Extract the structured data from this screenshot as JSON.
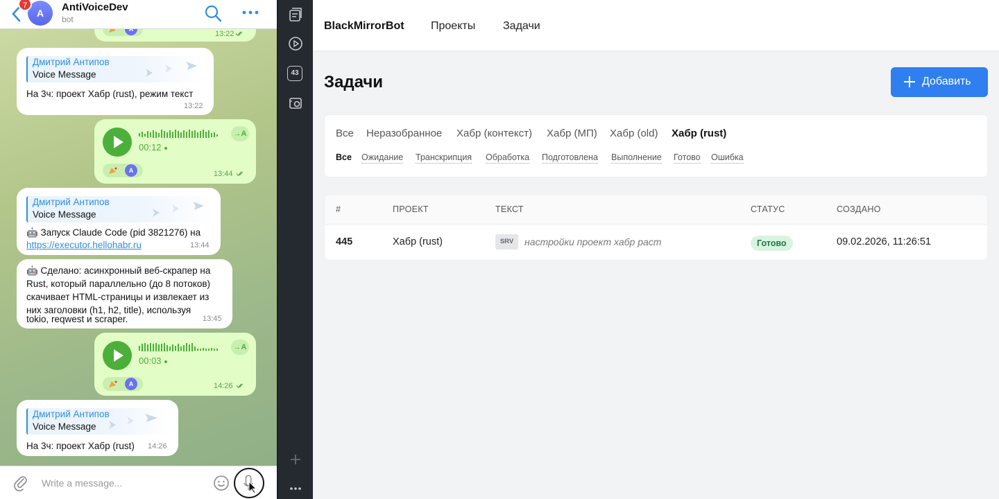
{
  "telegram": {
    "unread_count": "7",
    "chat_avatar_letter": "A",
    "chat_title": "AntiVoiceDev",
    "chat_subtitle": "bot",
    "compose_placeholder": "Write a message...",
    "messages": [
      {
        "kind": "voice",
        "time": "13:22"
      },
      {
        "kind": "forwarded",
        "sender": "Дмитрий Антипов",
        "type_label": "Voice Message",
        "text": "На 3ч: проект Хабр (rust), режим текст",
        "time": "13:22"
      },
      {
        "kind": "voice",
        "duration": "00:12",
        "to_text": "→A",
        "reaction_avatar": "A",
        "time": "13:44"
      },
      {
        "kind": "forwarded",
        "sender": "Дмитрий Антипов",
        "type_label": "Voice Message",
        "text": "🤖 Запуск Claude Code (pid 3821276) на",
        "link": "https://executor.hellohabr.ru",
        "time": "13:44"
      },
      {
        "kind": "text",
        "lines": [
          "🤖 Сделано: асинхронный веб-скрапер на",
          "Rust, который параллельно (до 8 потоков)",
          "скачивает HTML-страницы и извлекает из",
          "них заголовки (h1, h2, title), используя",
          "tokio, reqwest и scraper."
        ],
        "time": "13:45"
      },
      {
        "kind": "voice",
        "duration": "00:03",
        "to_text": "→A",
        "reaction_avatar": "A",
        "time": "14:26"
      },
      {
        "kind": "forwarded",
        "sender": "Дмитрий Антипов",
        "type_label": "Voice Message",
        "text": "На 3ч: проект Хабр (rust)",
        "time": "14:26"
      }
    ]
  },
  "dock": {
    "badge": "43"
  },
  "app": {
    "brand": "BlackMirrorBot",
    "nav": [
      "Проекты",
      "Задачи"
    ],
    "page_title": "Задачи",
    "add_button": "Добавить",
    "project_tabs": [
      "Все",
      "Неразобранное",
      "Хабр (контекст)",
      "Хабр (МП)",
      "Хабр (old)",
      "Хабр (rust)"
    ],
    "active_project_tab": "Хабр (rust)",
    "status_tabs": [
      "Все",
      "Ожидание",
      "Транскрипция",
      "Обработка",
      "Подготовлена",
      "Выполнение",
      "Готово",
      "Ошибка"
    ],
    "active_status_tab": "Все",
    "table": {
      "columns": [
        "#",
        "ПРОЕКТ",
        "ТЕКСТ",
        "СТАТУС",
        "СОЗДАНО"
      ],
      "rows": [
        {
          "id": "445",
          "project": "Хабр (rust)",
          "source": "SRV",
          "text": "настройки проект хабр раст",
          "status": "Готово",
          "created": "09.02.2026, 11:26:51"
        }
      ]
    },
    "colors": {
      "accent": "#2f7ff0",
      "status_done_bg": "#d9f3e0",
      "status_done_fg": "#1e7a3c"
    }
  }
}
